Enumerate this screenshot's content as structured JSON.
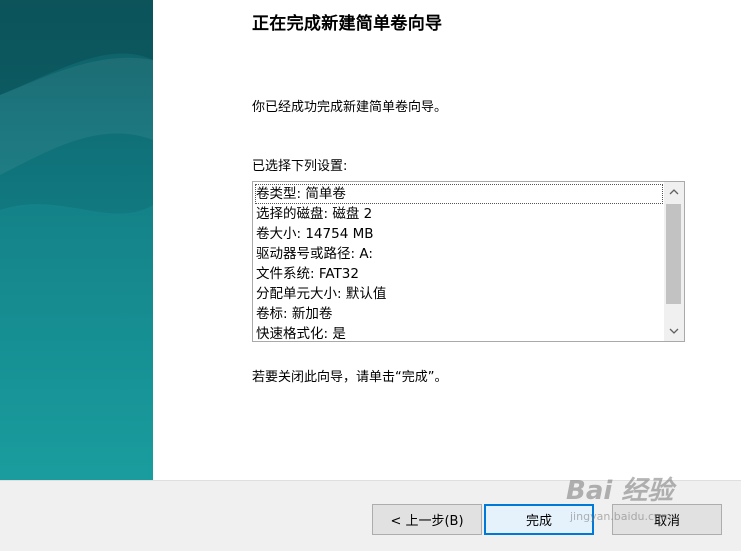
{
  "wizard": {
    "title": "正在完成新建简单卷向导",
    "intro": "你已经成功完成新建简单卷向导。",
    "settings_label": "已选择下列设置:",
    "settings": [
      "卷类型: 简单卷",
      "选择的磁盘: 磁盘 2",
      "卷大小: 14754 MB",
      "驱动器号或路径: A:",
      "文件系统: FAT32",
      "分配单元大小: 默认值",
      "卷标: 新加卷",
      "快速格式化: 是"
    ],
    "closing": "若要关闭此向导，请单击“完成”。",
    "buttons": {
      "back": "< 上一步(B)",
      "finish": "完成",
      "cancel": "取消"
    }
  },
  "watermark": {
    "text": "Bai 经验",
    "sub": "jingyan.baidu.com"
  },
  "icons": {
    "scroll_up": "chevron-up-icon",
    "scroll_down": "chevron-down-icon"
  },
  "colors": {
    "side_panel": "#137f86",
    "focus_border": "#0078d7",
    "footer": "#f0f0f0"
  }
}
